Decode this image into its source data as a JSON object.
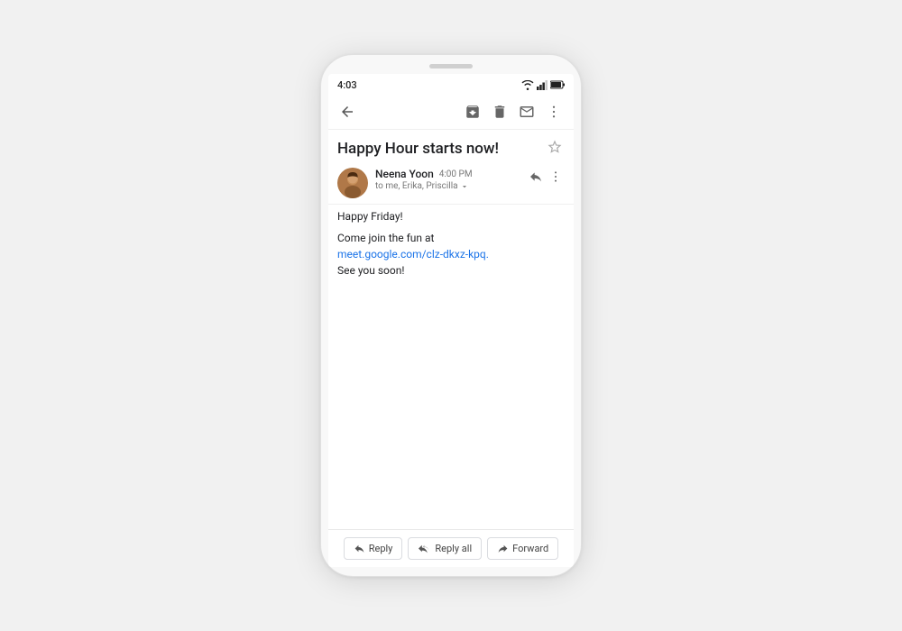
{
  "phone": {
    "status_bar": {
      "time": "4:03"
    },
    "toolbar": {
      "archive_label": "archive",
      "delete_label": "delete",
      "mail_label": "mark unread",
      "more_label": "more options"
    },
    "email": {
      "subject": "Happy Hour starts now!",
      "sender": {
        "name": "Neena Yoon",
        "time": "4:00 PM",
        "to": "to me, Erika, Priscilla"
      },
      "body_line1": "Happy Friday!",
      "body_line2": "Come join the fun at",
      "body_link": "meet.google.com/clz-dkxz-kpq.",
      "body_line3": "See you soon!"
    },
    "actions": {
      "reply": "Reply",
      "reply_all": "Reply all",
      "forward": "Forward"
    }
  }
}
